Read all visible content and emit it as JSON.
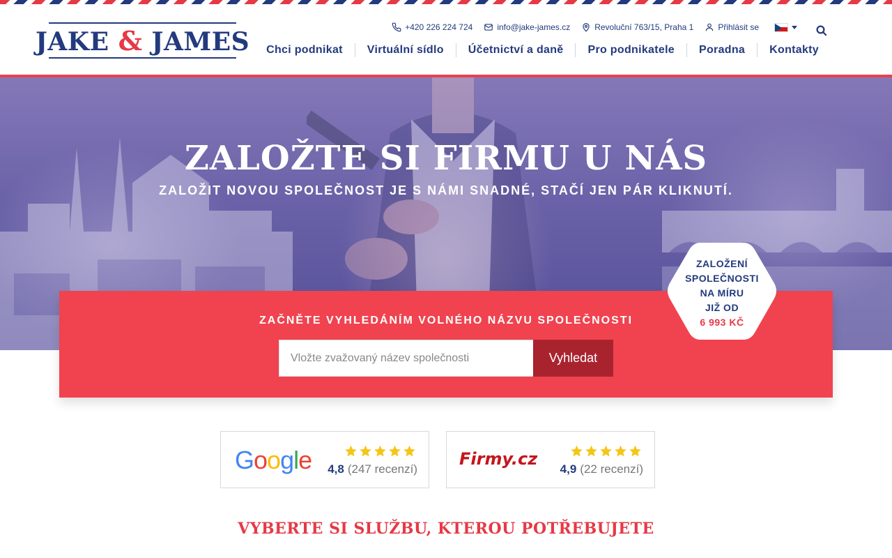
{
  "brand": {
    "logo_left": "JAKE",
    "logo_amp": "&",
    "logo_right": "JAMES"
  },
  "contact": {
    "phone": "+420 226 224 724",
    "email": "info@jake-james.cz",
    "address": "Revoluční 763/15, Praha 1",
    "login": "Přihlásit se",
    "language": "cs"
  },
  "nav": {
    "items": [
      {
        "label": "Chci podnikat"
      },
      {
        "label": "Virtuální sídlo"
      },
      {
        "label": "Účetnictví a daně"
      },
      {
        "label": "Pro podnikatele"
      },
      {
        "label": "Poradna"
      },
      {
        "label": "Kontakty"
      }
    ]
  },
  "hero": {
    "title": "ZALOŽTE SI FIRMU U NÁS",
    "subtitle": "ZALOŽIT NOVOU SPOLEČNOST JE S NÁMI SNADNÉ, STAČÍ JEN PÁR KLIKNUTÍ."
  },
  "search": {
    "heading": "ZAČNĚTE VYHLEDÁNÍM VOLNÉHO NÁZVU SPOLEČNOSTI",
    "placeholder": "Vložte zvažovaný název společnosti",
    "value": "",
    "button": "Vyhledat"
  },
  "badge": {
    "line1": "ZALOŽENÍ",
    "line2": "SPOLEČNOSTI",
    "line3": "NA MÍRU",
    "line4": "JIŽ OD",
    "price": "6 993 KČ"
  },
  "ratings": {
    "google": {
      "brand": "Google",
      "stars": 5,
      "score": "4,8",
      "count": "(247 recenzí)"
    },
    "firmy": {
      "brand": "Firmy.cz",
      "stars": 5,
      "score": "4,9",
      "count": "(22 recenzí)"
    }
  },
  "services": {
    "title": "VYBERTE SI SLUŽBU, KTEROU POTŘEBUJETE"
  },
  "colors": {
    "navy": "#233a7e",
    "red": "#e63946",
    "panel": "#f0434f",
    "button": "#a9232e",
    "star": "#f5c518"
  }
}
